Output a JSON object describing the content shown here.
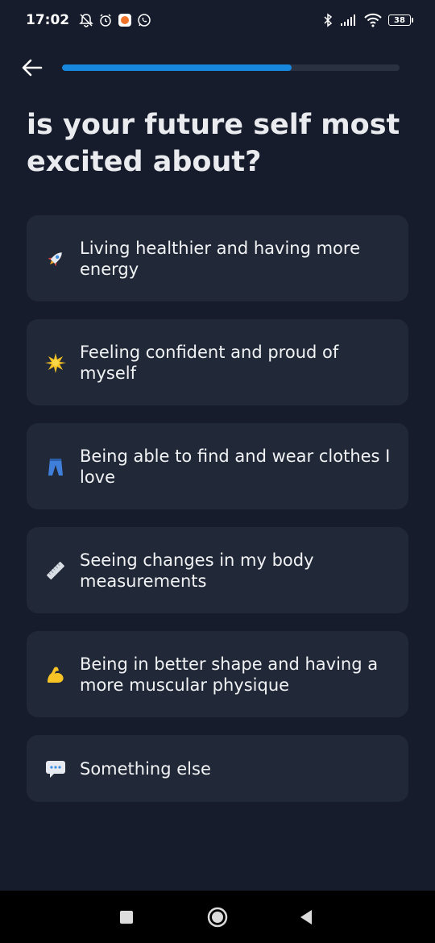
{
  "status_bar": {
    "time": "17:02",
    "battery": "38",
    "icons": [
      "bell-off-icon",
      "alarm-icon",
      "app-notification-icon",
      "whatsapp-icon",
      "bluetooth-icon",
      "signal-icon",
      "wifi-icon",
      "battery-icon"
    ]
  },
  "header": {
    "back_icon": "arrow-left-icon",
    "progress": 0.68,
    "progress_color": "#1787dd"
  },
  "question": {
    "title": "is your future self most excited about?"
  },
  "options": [
    {
      "icon": "rocket-icon",
      "label": "Living healthier and having more energy"
    },
    {
      "icon": "sparkle-star-icon",
      "label": "Feeling confident and proud of myself"
    },
    {
      "icon": "jeans-icon",
      "label": "Being able to find and wear clothes I love"
    },
    {
      "icon": "ruler-icon",
      "label": "Seeing changes in my body measurements"
    },
    {
      "icon": "flexed-biceps-icon",
      "label": "Being in better shape and having a more muscular physique"
    },
    {
      "icon": "speech-bubble-icon",
      "label": "Something else"
    }
  ],
  "nav_bar": {
    "buttons": [
      "recents-square-icon",
      "home-circle-icon",
      "back-triangle-icon"
    ]
  },
  "colors": {
    "background": "#161c2b",
    "card": "#212837",
    "accent": "#1787dd"
  }
}
